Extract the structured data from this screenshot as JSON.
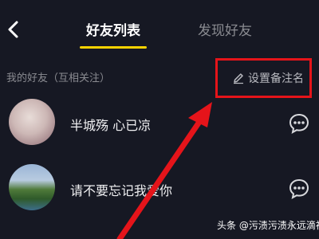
{
  "header": {
    "tabs": [
      {
        "label": "好友列表",
        "active": true
      },
      {
        "label": "发现好友",
        "active": false
      }
    ],
    "accent_color": "#fbd400",
    "back_icon": "chevron-left-icon"
  },
  "friends_section": {
    "title": "我的好友（互相关注）",
    "set_remark_label": "设置备注名",
    "set_remark_icon": "pencil-icon"
  },
  "friends": [
    {
      "name": "半城殇 心已凉",
      "action_icon": "chat-bubble-icon"
    },
    {
      "name": "请不要忘记我爱你",
      "action_icon": "chat-bubble-icon"
    }
  ],
  "annotation": {
    "highlight_color": "#e5141a"
  },
  "watermark": {
    "text": "头条 @污渍污渍永远滴神"
  }
}
